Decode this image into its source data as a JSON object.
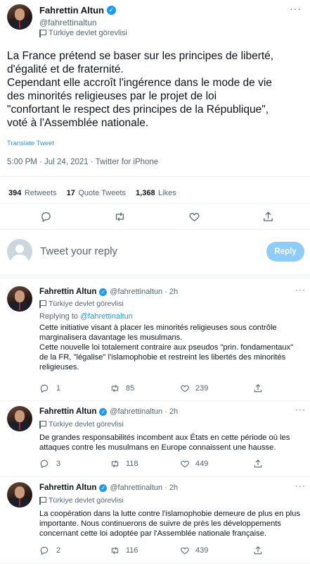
{
  "main_tweet": {
    "name": "Fahrettin Altun",
    "handle": "@fahrettinaltun",
    "gov_label": "Türkiye devlet görevlisi",
    "text_lines": [
      "La France prétend se baser sur les principes de liberté,",
      "d'égalité et de fraternité.",
      "Cependant elle accroît l'ingérence dans le mode de vie",
      "des minorités religieuses par le projet de loi",
      "\"confortant le respect des principes de la République\",",
      "voté à l'Assemblée nationale."
    ],
    "translate": "Translate Tweet",
    "timestamp": "5:00 PM · Jul 24, 2021 · Twitter for iPhone",
    "retweets_count": "394",
    "retweets_label": "Retweets",
    "quotes_count": "17",
    "quotes_label": "Quote Tweets",
    "likes_count": "1,368",
    "likes_label": "Likes"
  },
  "compose": {
    "placeholder": "Tweet your reply",
    "reply_button": "Reply"
  },
  "replies": [
    {
      "name": "Fahrettin Altun",
      "handle": "@fahrettinaltun · 2h",
      "gov_label": "Türkiye devlet görevlisi",
      "replying_prefix": "Replying to ",
      "replying_to": "@fahrettinaltun",
      "text_lines": [
        "Cette initiative visant à placer les minorités religieuses sous contrôle",
        "marginalisera davantage les musulmans.",
        "Cette nouvelle loi totalement contraire aux pseudos \"prin. fondamentaux\"",
        "de la FR, \"légalise\" l'islamophobie et restreint les libertés des minorités",
        "religieuses."
      ],
      "reply_count": "1",
      "retweet_count": "85",
      "like_count": "239"
    },
    {
      "name": "Fahrettin Altun",
      "handle": "@fahrettinaltun · 2h",
      "gov_label": "Türkiye devlet görevlisi",
      "text_lines": [
        "De grandes responsabilités incombent aux États en cette période où les",
        "attaques contre les musulmans en Europe connaissent une hausse."
      ],
      "reply_count": "3",
      "retweet_count": "118",
      "like_count": "449"
    },
    {
      "name": "Fahrettin Altun",
      "handle": "@fahrettinaltun · 2h",
      "gov_label": "Türkiye devlet görevlisi",
      "text_lines": [
        "La coopération dans la lutte contre l'islamophobie demeure de plus en plus",
        "importante. Nous continuerons de suivre de près les développements",
        "concernant cette loi adoptée par l'Assemblée nationale française."
      ],
      "reply_count": "2",
      "retweet_count": "116",
      "like_count": "439"
    }
  ],
  "colors": {
    "accent": "#1d9bf0",
    "reply_button_bg": "#8ecdf7",
    "text": "#0f1419",
    "secondary": "#536471"
  },
  "icons": {
    "verified": "verified-badge-icon",
    "flag": "flag-icon",
    "reply": "reply-icon",
    "retweet": "retweet-icon",
    "like": "heart-icon",
    "share": "share-icon",
    "more": "more-icon"
  }
}
